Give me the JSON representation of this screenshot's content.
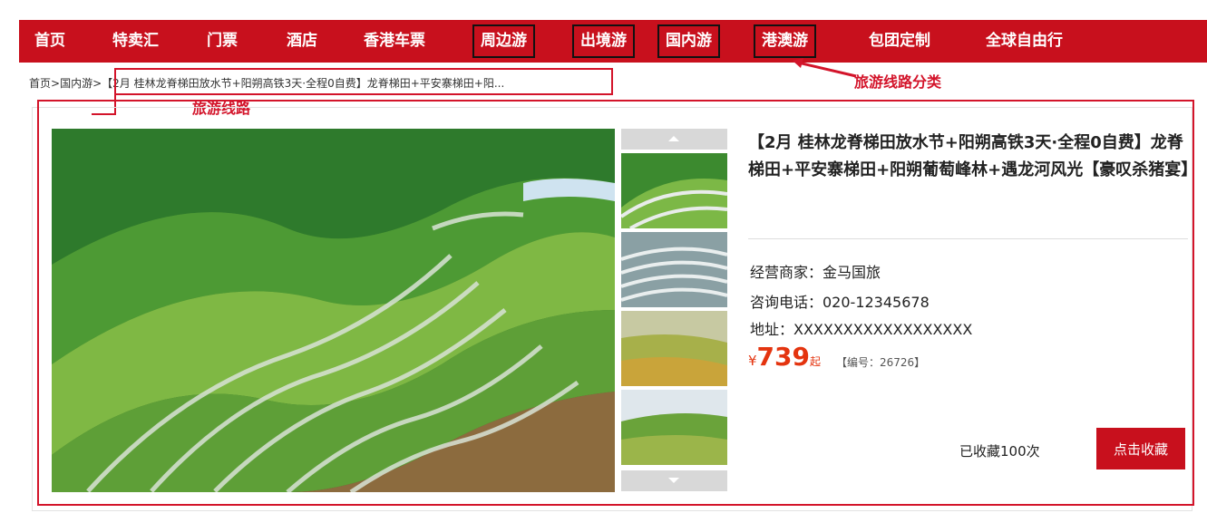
{
  "nav": {
    "items": [
      {
        "label": "首页",
        "boxed": false
      },
      {
        "label": "特卖汇",
        "boxed": false
      },
      {
        "label": "门票",
        "boxed": false
      },
      {
        "label": "酒店",
        "boxed": false
      },
      {
        "label": "香港车票",
        "boxed": false
      },
      {
        "label": "周边游",
        "boxed": true
      },
      {
        "label": "出境游",
        "boxed": true
      },
      {
        "label": "国内游",
        "boxed": true
      },
      {
        "label": "港澳游",
        "boxed": true
      },
      {
        "label": "包团定制",
        "boxed": false
      },
      {
        "label": "全球自由行",
        "boxed": false
      }
    ]
  },
  "breadcrumb": {
    "home": "首页",
    "sep": ">",
    "category": "国内游",
    "current": "【2月 桂林龙脊梯田放水节+阳朔高铁3天·全程0自费】龙脊梯田+平安寨梯田+阳..."
  },
  "annotations": {
    "category_label": "旅游线路分类",
    "route_label": "旅游线路"
  },
  "product": {
    "title": "【2月 桂林龙脊梯田放水节+阳朔高铁3天·全程0自费】龙脊梯田+平安寨梯田+阳朔葡萄峰林+遇龙河风光【豪叹杀猪宴】",
    "merchant": "经营商家：金马国旅",
    "phone": "咨询电话：020-12345678",
    "address": "地址：XXXXXXXXXXXXXXXXXX",
    "price_currency": "¥",
    "price_value": "739",
    "price_suffix": "起",
    "code": "【编号：26726】",
    "fav_count": "已收藏100次",
    "fav_button": "点击收藏"
  },
  "colors": {
    "brand_red": "#c8101d",
    "annotation_red": "#d3142a",
    "price_orange": "#e4340f"
  },
  "icons": [
    "arrow-up-icon",
    "arrow-down-icon"
  ]
}
